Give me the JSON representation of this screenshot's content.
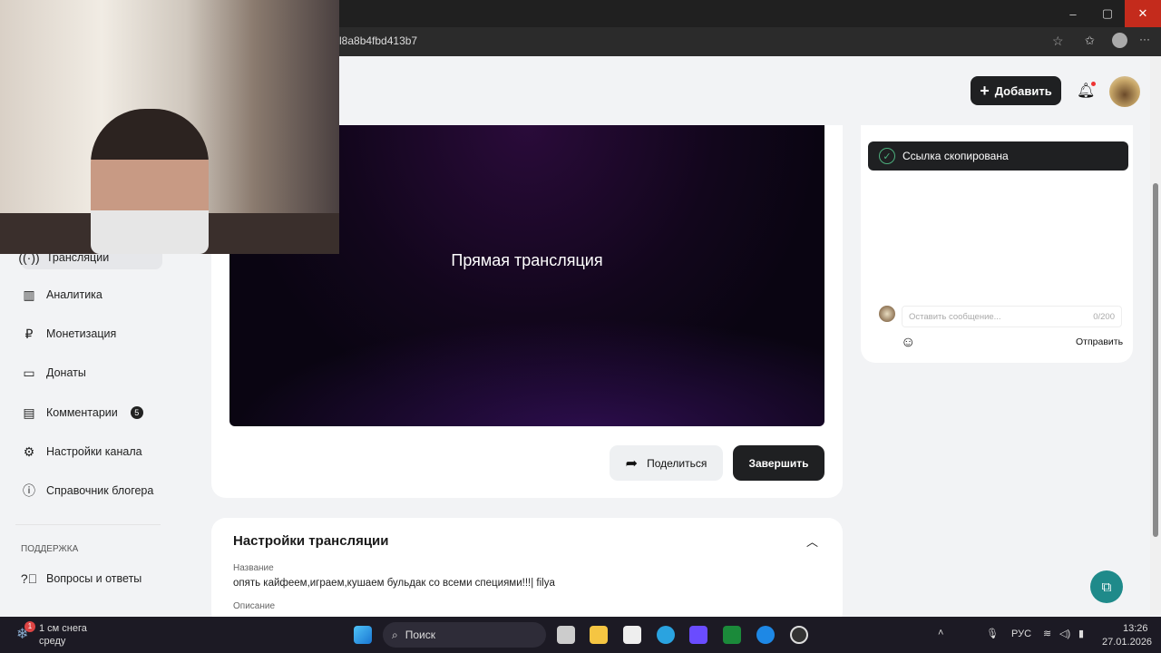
{
  "browser": {
    "url": "l8a8b4fbd413b7"
  },
  "header": {
    "add_label": "Добавить"
  },
  "sidebar": {
    "items": [
      {
        "label": "Трансляции",
        "icon": "broadcast-icon"
      },
      {
        "label": "Аналитика",
        "icon": "chart-icon"
      },
      {
        "label": "Монетизация",
        "icon": "ruble-icon"
      },
      {
        "label": "Донаты",
        "icon": "wallet-icon"
      },
      {
        "label": "Комментарии",
        "icon": "comment-icon",
        "badge": "5"
      },
      {
        "label": "Настройки канала",
        "icon": "gear-icon"
      },
      {
        "label": "Справочник блогера",
        "icon": "info-icon"
      }
    ],
    "support_heading": "ПОДДЕРЖКА",
    "support_items": [
      {
        "label": "Вопросы и ответы",
        "icon": "question-icon"
      }
    ]
  },
  "stream": {
    "title": "Прямая трансляция",
    "share_label": "Поделиться",
    "finish_label": "Завершить"
  },
  "settings": {
    "heading": "Настройки трансляции",
    "name_label": "Название",
    "name_value": "опять кайфеем,играем,кушаем бульдак со всеми специями!!!| filya",
    "description_label": "Описание"
  },
  "chat": {
    "toast": "Ссылка скопирована",
    "placeholder": "Оставить сообщение...",
    "counter": "0/200",
    "send_label": "Отправить"
  },
  "taskbar": {
    "weather": "1 см снега",
    "weather_sub": "среду",
    "weather_badge": "1",
    "search": "Поиск",
    "lang": "РУС",
    "time": "13:26",
    "date": "27.01.2026"
  }
}
